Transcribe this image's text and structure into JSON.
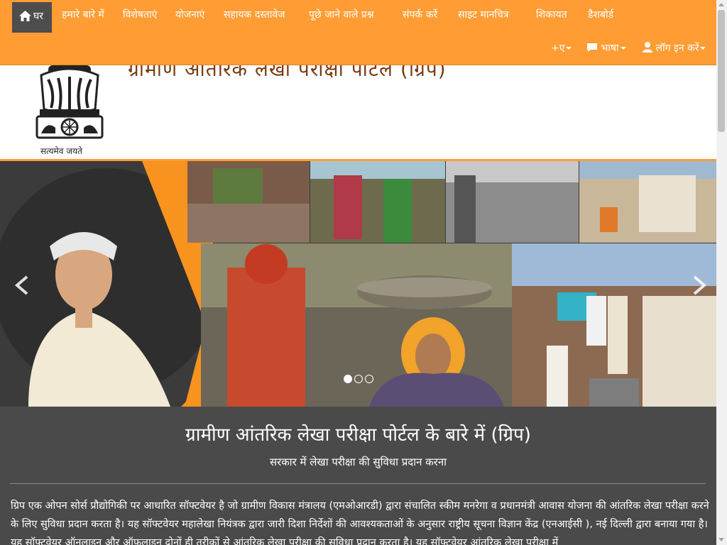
{
  "nav": {
    "home_label": "घर",
    "items": [
      {
        "label": "हमारे बारे में"
      },
      {
        "label": "विशेषताएं"
      },
      {
        "label": "योजनाएं"
      },
      {
        "label": "सहायक दस्तावेज"
      },
      {
        "label": "पूछे जाने वाले प्रश्न"
      },
      {
        "label": "संपर्क करें"
      },
      {
        "label": "साइट मानचित्र"
      },
      {
        "label": "शिकायत"
      },
      {
        "label": "डैशबोर्ड"
      }
    ],
    "font_label": "+ए",
    "language_label": "भाषा",
    "login_label": "लॉग इन करें"
  },
  "banner": {
    "emblem_caption": "सत्यमेव जयते",
    "title_partial": "ग्रामीण आंतरिक लेखा परीक्षा पोर्टल (ग्रिप)"
  },
  "carousel": {
    "slide_count": 3,
    "active_slide": 1
  },
  "about": {
    "heading": "ग्रामीण आंतरिक लेखा परीक्षा पोर्टल के बारे में (ग्रिप)",
    "subheading": "सरकार में लेखा परीक्षा की सुविधा प्रदान करना",
    "body": "ग्रिप एक ओपन सोर्स प्रौद्योगिकी पर आधारित सॉफ्टवेयर है जो ग्रामीण विकास मंत्रालय (एमओआरडी) द्वारा संचालित स्कीम मनरेगा व प्रधानमंत्री आवास योजना की आंतरिक लेखा परीक्षा करने के लिए सुविधा प्रदान करता है। यह सॉफ्टवेयर महालेखा नियंत्रक द्वारा जारी दिशा निर्देशों की आवश्यकताओं के अनुसार राष्ट्रीय सूचना विज्ञान केंद्र (एनआईसी ), नई दिल्ली द्वारा बनाया गया है। यह सॉफ्टवेयर ऑनलाइन और ऑफ़लाइन दोनों ही तरीकों से आंतरिक लेखा परीक्षा की सुविधा प्रदान करता है। यह सॉफ्टवेयर आंतरिक लेखा परीक्षा में"
  },
  "colors": {
    "nav_bg": "#ff9c33",
    "home_bg": "#4d4d4d",
    "about_bg": "#4a4a4a"
  }
}
